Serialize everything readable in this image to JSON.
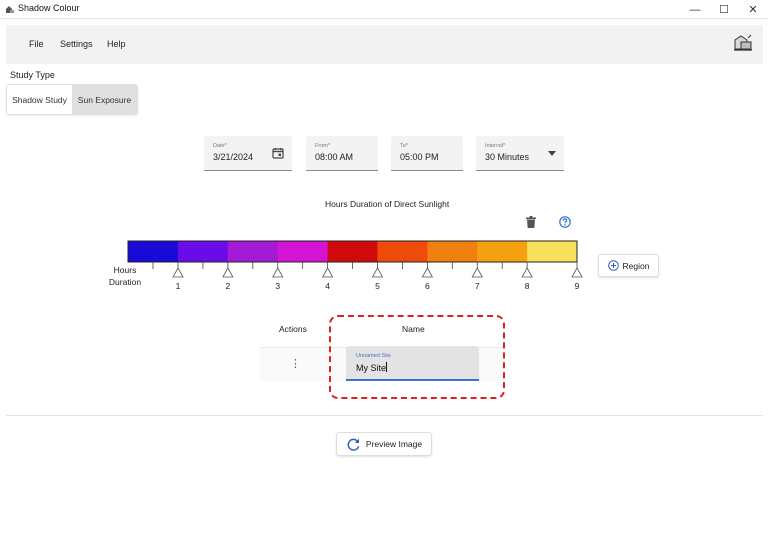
{
  "window": {
    "title": "Shadow Colour",
    "minimize": "—",
    "maximize": "☐",
    "close": "✕"
  },
  "menu": {
    "items": [
      "File",
      "Settings",
      "Help"
    ],
    "logo_icon": "building-icon"
  },
  "study_type": {
    "label": "Study Type",
    "options": [
      "Shadow Study",
      "Sun Exposure"
    ],
    "selected": "Sun Exposure"
  },
  "fields": {
    "date": {
      "label": "Date*",
      "value": "3/21/2024",
      "icon": "calendar-icon"
    },
    "from": {
      "label": "From*",
      "value": "08:00 AM"
    },
    "to": {
      "label": "To*",
      "value": "05:00 PM"
    },
    "interval": {
      "label": "Interval*",
      "value": "30 Minutes",
      "icon": "caret-down-icon"
    }
  },
  "legend": {
    "title": "Hours Duration of Direct Sunlight",
    "axis_label_line1": "Hours",
    "axis_label_line2": "Duration",
    "colors": [
      "#1a0ad8",
      "#6a0ce8",
      "#a41ad6",
      "#d414d4",
      "#d00a0a",
      "#ee4a0a",
      "#ef8010",
      "#f5a00f",
      "#f9e05a"
    ],
    "ticks": [
      "1",
      "2",
      "3",
      "4",
      "5",
      "6",
      "7",
      "8",
      "9"
    ],
    "delete_icon": "trash-icon",
    "help_icon": "help-circle-icon"
  },
  "region_button": {
    "label": "Region",
    "icon": "plus-circle-icon"
  },
  "table": {
    "headers": {
      "actions": "Actions",
      "name": "Name"
    },
    "rows": [
      {
        "actions_icon": "kebab-menu-icon",
        "name_label": "Unnamed Site",
        "name_value": "My Site"
      }
    ]
  },
  "preview_button": {
    "label": "Preview Image",
    "icon": "refresh-icon"
  }
}
